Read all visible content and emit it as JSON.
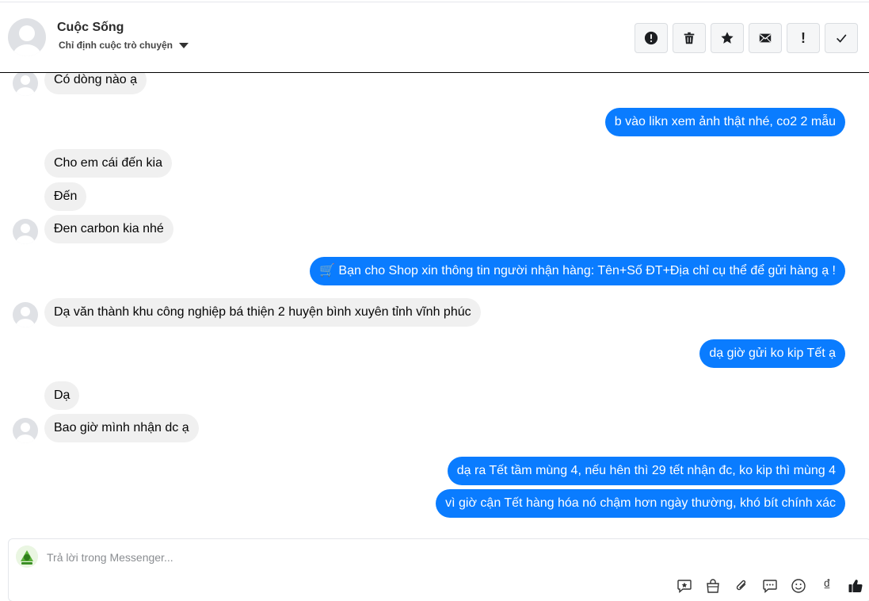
{
  "header": {
    "contact_name": "Cuộc Sống",
    "assign_label": "Chỉ định cuộc trò chuyện",
    "actions": [
      {
        "name": "spam-button",
        "icon": "exclamation-circle-icon"
      },
      {
        "name": "delete-button",
        "icon": "trash-icon"
      },
      {
        "name": "star-button",
        "icon": "star-icon"
      },
      {
        "name": "mark-unread-button",
        "icon": "envelope-icon"
      },
      {
        "name": "follow-up-button",
        "icon": "exclamation-icon",
        "glyph": "!"
      },
      {
        "name": "mark-done-button",
        "icon": "check-icon"
      }
    ]
  },
  "messages": [
    {
      "dir": "in",
      "text": "Có dòng nào ạ"
    },
    {
      "dir": "out",
      "text": "b vào likn xem ảnh thật nhé, co2 2 mẫu"
    },
    {
      "dir": "in",
      "text": "Cho em cái đến kia"
    },
    {
      "dir": "in",
      "text": "Đến"
    },
    {
      "dir": "in",
      "text": "Đen carbon kia nhé"
    },
    {
      "dir": "out",
      "text": "🛒 Bạn cho Shop xin thông tin người nhận hàng: Tên+Số ĐT+Địa chỉ cụ thể để gửi hàng ạ !"
    },
    {
      "dir": "in",
      "text": "Dạ văn thành  khu công nghiệp bá thiện 2 huyện bình xuyên tỉnh vĩnh phúc"
    },
    {
      "dir": "out",
      "text": "dạ giờ gửi ko kip Tết ạ"
    },
    {
      "dir": "in",
      "text": "Dạ"
    },
    {
      "dir": "in",
      "text": "Bao giờ mình nhận dc ạ"
    },
    {
      "dir": "out",
      "text": "dạ ra Tết tầm mùng 4, nếu hên thì 29 tết nhận đc, ko kip thì mùng 4"
    },
    {
      "dir": "out",
      "text": "vì giờ cận Tết hàng hóa nó chậm hơn ngày thường, khó bít chính xác"
    }
  ],
  "composer": {
    "placeholder": "Trả lời trong Messenger...",
    "tools": [
      {
        "name": "saved-reply-button",
        "icon": "chat-star-icon"
      },
      {
        "name": "shop-bag-button",
        "icon": "shopping-bag-icon"
      },
      {
        "name": "attach-button",
        "icon": "paperclip-icon"
      },
      {
        "name": "quick-reply-button",
        "icon": "chat-dots-icon"
      },
      {
        "name": "emoji-button",
        "icon": "smiley-icon"
      },
      {
        "name": "payment-button",
        "icon": "dong-currency-icon",
        "glyph": "₫"
      },
      {
        "name": "like-button",
        "icon": "thumbs-up-icon"
      }
    ]
  },
  "colors": {
    "outgoing_bubble": "#0a7cff",
    "incoming_bubble": "#f0f0f0"
  }
}
